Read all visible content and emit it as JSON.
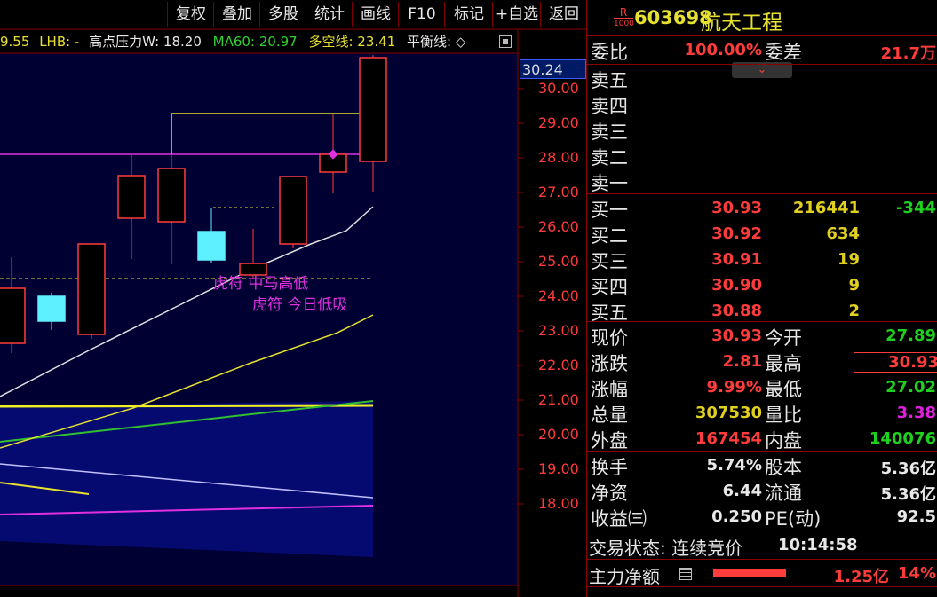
{
  "toolbar": {
    "buttons": [
      "复权",
      "叠加",
      "多股",
      "统计",
      "画线",
      "F10",
      "标记",
      "+自选",
      "返回"
    ]
  },
  "indicators": {
    "prefix": "9.55",
    "lhb": "LHB: -",
    "high_pressure": "高点压力W: 18.20",
    "ma60": "MA60: 20.97",
    "long_short": "多空线: 23.41",
    "balance": "平衡线: ◇"
  },
  "chart": {
    "current_price_tag": "30.24",
    "y_ticks": [
      "30.00",
      "29.00",
      "28.00",
      "27.00",
      "26.00",
      "25.00",
      "24.00",
      "23.00",
      "22.00",
      "21.00",
      "20.00",
      "19.00",
      "18.00"
    ],
    "annotation1": "虎符 中马高低",
    "annotation2": "虎符 今日低吸",
    "colors": {
      "up": "#ff3c3c",
      "down": "#5ff0ff",
      "bg": "#000033",
      "ma_white": "#e0e0e0",
      "ma_yellow": "#e6e030",
      "magenta": "#e030e0",
      "green": "#30c030"
    }
  },
  "stock": {
    "badge_top": "R",
    "badge_bottom": "1000",
    "code": "603698",
    "name": "航天工程"
  },
  "order_book": {
    "weibi_label": "委比",
    "weibi_value": "100.00%",
    "weicha_label": "委差",
    "weicha_value": "21.7万",
    "sells": [
      {
        "label": "卖五"
      },
      {
        "label": "卖四"
      },
      {
        "label": "卖三"
      },
      {
        "label": "卖二"
      },
      {
        "label": "卖一"
      }
    ],
    "buys": [
      {
        "label": "买一",
        "price": "30.93",
        "vol": "216441",
        "chg": "-344"
      },
      {
        "label": "买二",
        "price": "30.92",
        "vol": "634",
        "chg": ""
      },
      {
        "label": "买三",
        "price": "30.91",
        "vol": "19",
        "chg": ""
      },
      {
        "label": "买四",
        "price": "30.90",
        "vol": "9",
        "chg": ""
      },
      {
        "label": "买五",
        "price": "30.88",
        "vol": "2",
        "chg": ""
      }
    ]
  },
  "quote": {
    "rows": [
      {
        "l1": "现价",
        "v1": "30.93",
        "c1": "red",
        "l2": "今开",
        "v2": "27.89",
        "c2": "green"
      },
      {
        "l1": "涨跌",
        "v1": "2.81",
        "c1": "red",
        "l2": "最高",
        "v2": "30.93",
        "c2": "red"
      },
      {
        "l1": "涨幅",
        "v1": "9.99%",
        "c1": "red",
        "l2": "最低",
        "v2": "27.02",
        "c2": "green"
      },
      {
        "l1": "总量",
        "v1": "307530",
        "c1": "yellow",
        "l2": "量比",
        "v2": "3.38",
        "c2": "mag"
      },
      {
        "l1": "外盘",
        "v1": "167454",
        "c1": "red",
        "l2": "内盘",
        "v2": "140076",
        "c2": "green"
      }
    ]
  },
  "fundamentals": {
    "rows": [
      {
        "l1": "换手",
        "v1": "5.74%",
        "l2": "股本",
        "v2": "5.36亿"
      },
      {
        "l1": "净资",
        "v1": "6.44",
        "l2": "流通",
        "v2": "5.36亿"
      },
      {
        "l1": "收益㈢",
        "v1": "0.250",
        "l2": "PE(动)",
        "v2": "92.5"
      }
    ]
  },
  "status": {
    "label": "交易状态: 连续竞价",
    "time": "10:14:58"
  },
  "main_flow": {
    "label": "主力净额",
    "value": "1.25亿",
    "pct": "14%"
  }
}
